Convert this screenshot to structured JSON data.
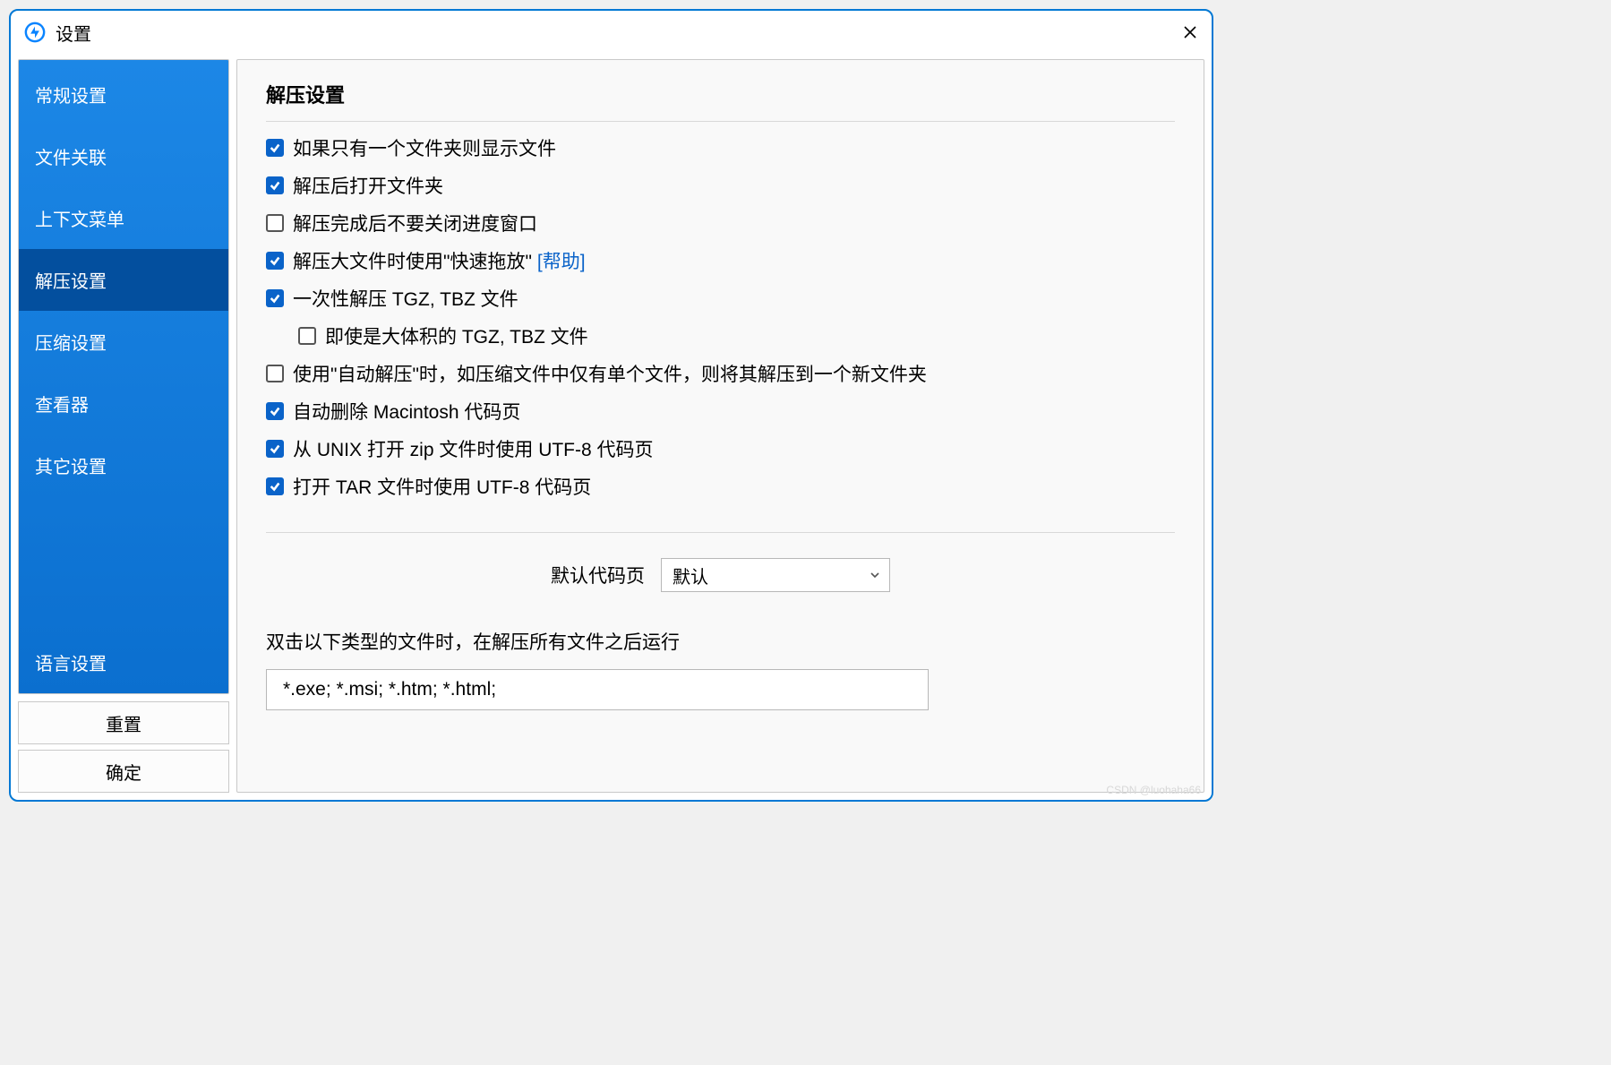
{
  "window": {
    "title": "设置"
  },
  "sidebar": {
    "items": [
      {
        "id": "general",
        "label": "常规设置",
        "selected": false
      },
      {
        "id": "assoc",
        "label": "文件关联",
        "selected": false
      },
      {
        "id": "context",
        "label": "上下文菜单",
        "selected": false
      },
      {
        "id": "extract",
        "label": "解压设置",
        "selected": true
      },
      {
        "id": "compress",
        "label": "压缩设置",
        "selected": false
      },
      {
        "id": "viewer",
        "label": "查看器",
        "selected": false
      },
      {
        "id": "other",
        "label": "其它设置",
        "selected": false
      }
    ],
    "language_label": "语言设置",
    "reset_label": "重置",
    "ok_label": "确定"
  },
  "main": {
    "section_title": "解压设置",
    "options": [
      {
        "id": "single-folder",
        "label": "如果只有一个文件夹则显示文件",
        "checked": true,
        "indent": false
      },
      {
        "id": "open-after",
        "label": "解压后打开文件夹",
        "checked": true,
        "indent": false
      },
      {
        "id": "keep-progress",
        "label": "解压完成后不要关闭进度窗口",
        "checked": false,
        "indent": false
      },
      {
        "id": "fast-drag",
        "label": "解压大文件时使用\"快速拖放\"",
        "checked": true,
        "indent": false,
        "help": "[帮助]"
      },
      {
        "id": "tgz-once",
        "label": "一次性解压 TGZ, TBZ 文件",
        "checked": true,
        "indent": false
      },
      {
        "id": "tgz-large",
        "label": "即使是大体积的 TGZ, TBZ 文件",
        "checked": false,
        "indent": true
      },
      {
        "id": "auto-newdir",
        "label": "使用\"自动解压\"时，如压缩文件中仅有单个文件，则将其解压到一个新文件夹",
        "checked": false,
        "indent": false
      },
      {
        "id": "mac-codepage",
        "label": "自动删除 Macintosh 代码页",
        "checked": true,
        "indent": false
      },
      {
        "id": "unix-utf8",
        "label": "从 UNIX 打开 zip 文件时使用 UTF-8 代码页",
        "checked": true,
        "indent": false
      },
      {
        "id": "tar-utf8",
        "label": "打开 TAR 文件时使用 UTF-8 代码页",
        "checked": true,
        "indent": false
      }
    ],
    "codepage": {
      "label": "默认代码页",
      "value": "默认"
    },
    "ext_run": {
      "label": "双击以下类型的文件时，在解压所有文件之后运行",
      "value": "*.exe; *.msi; *.htm; *.html;"
    }
  },
  "watermark": "CSDN @luohaha66"
}
